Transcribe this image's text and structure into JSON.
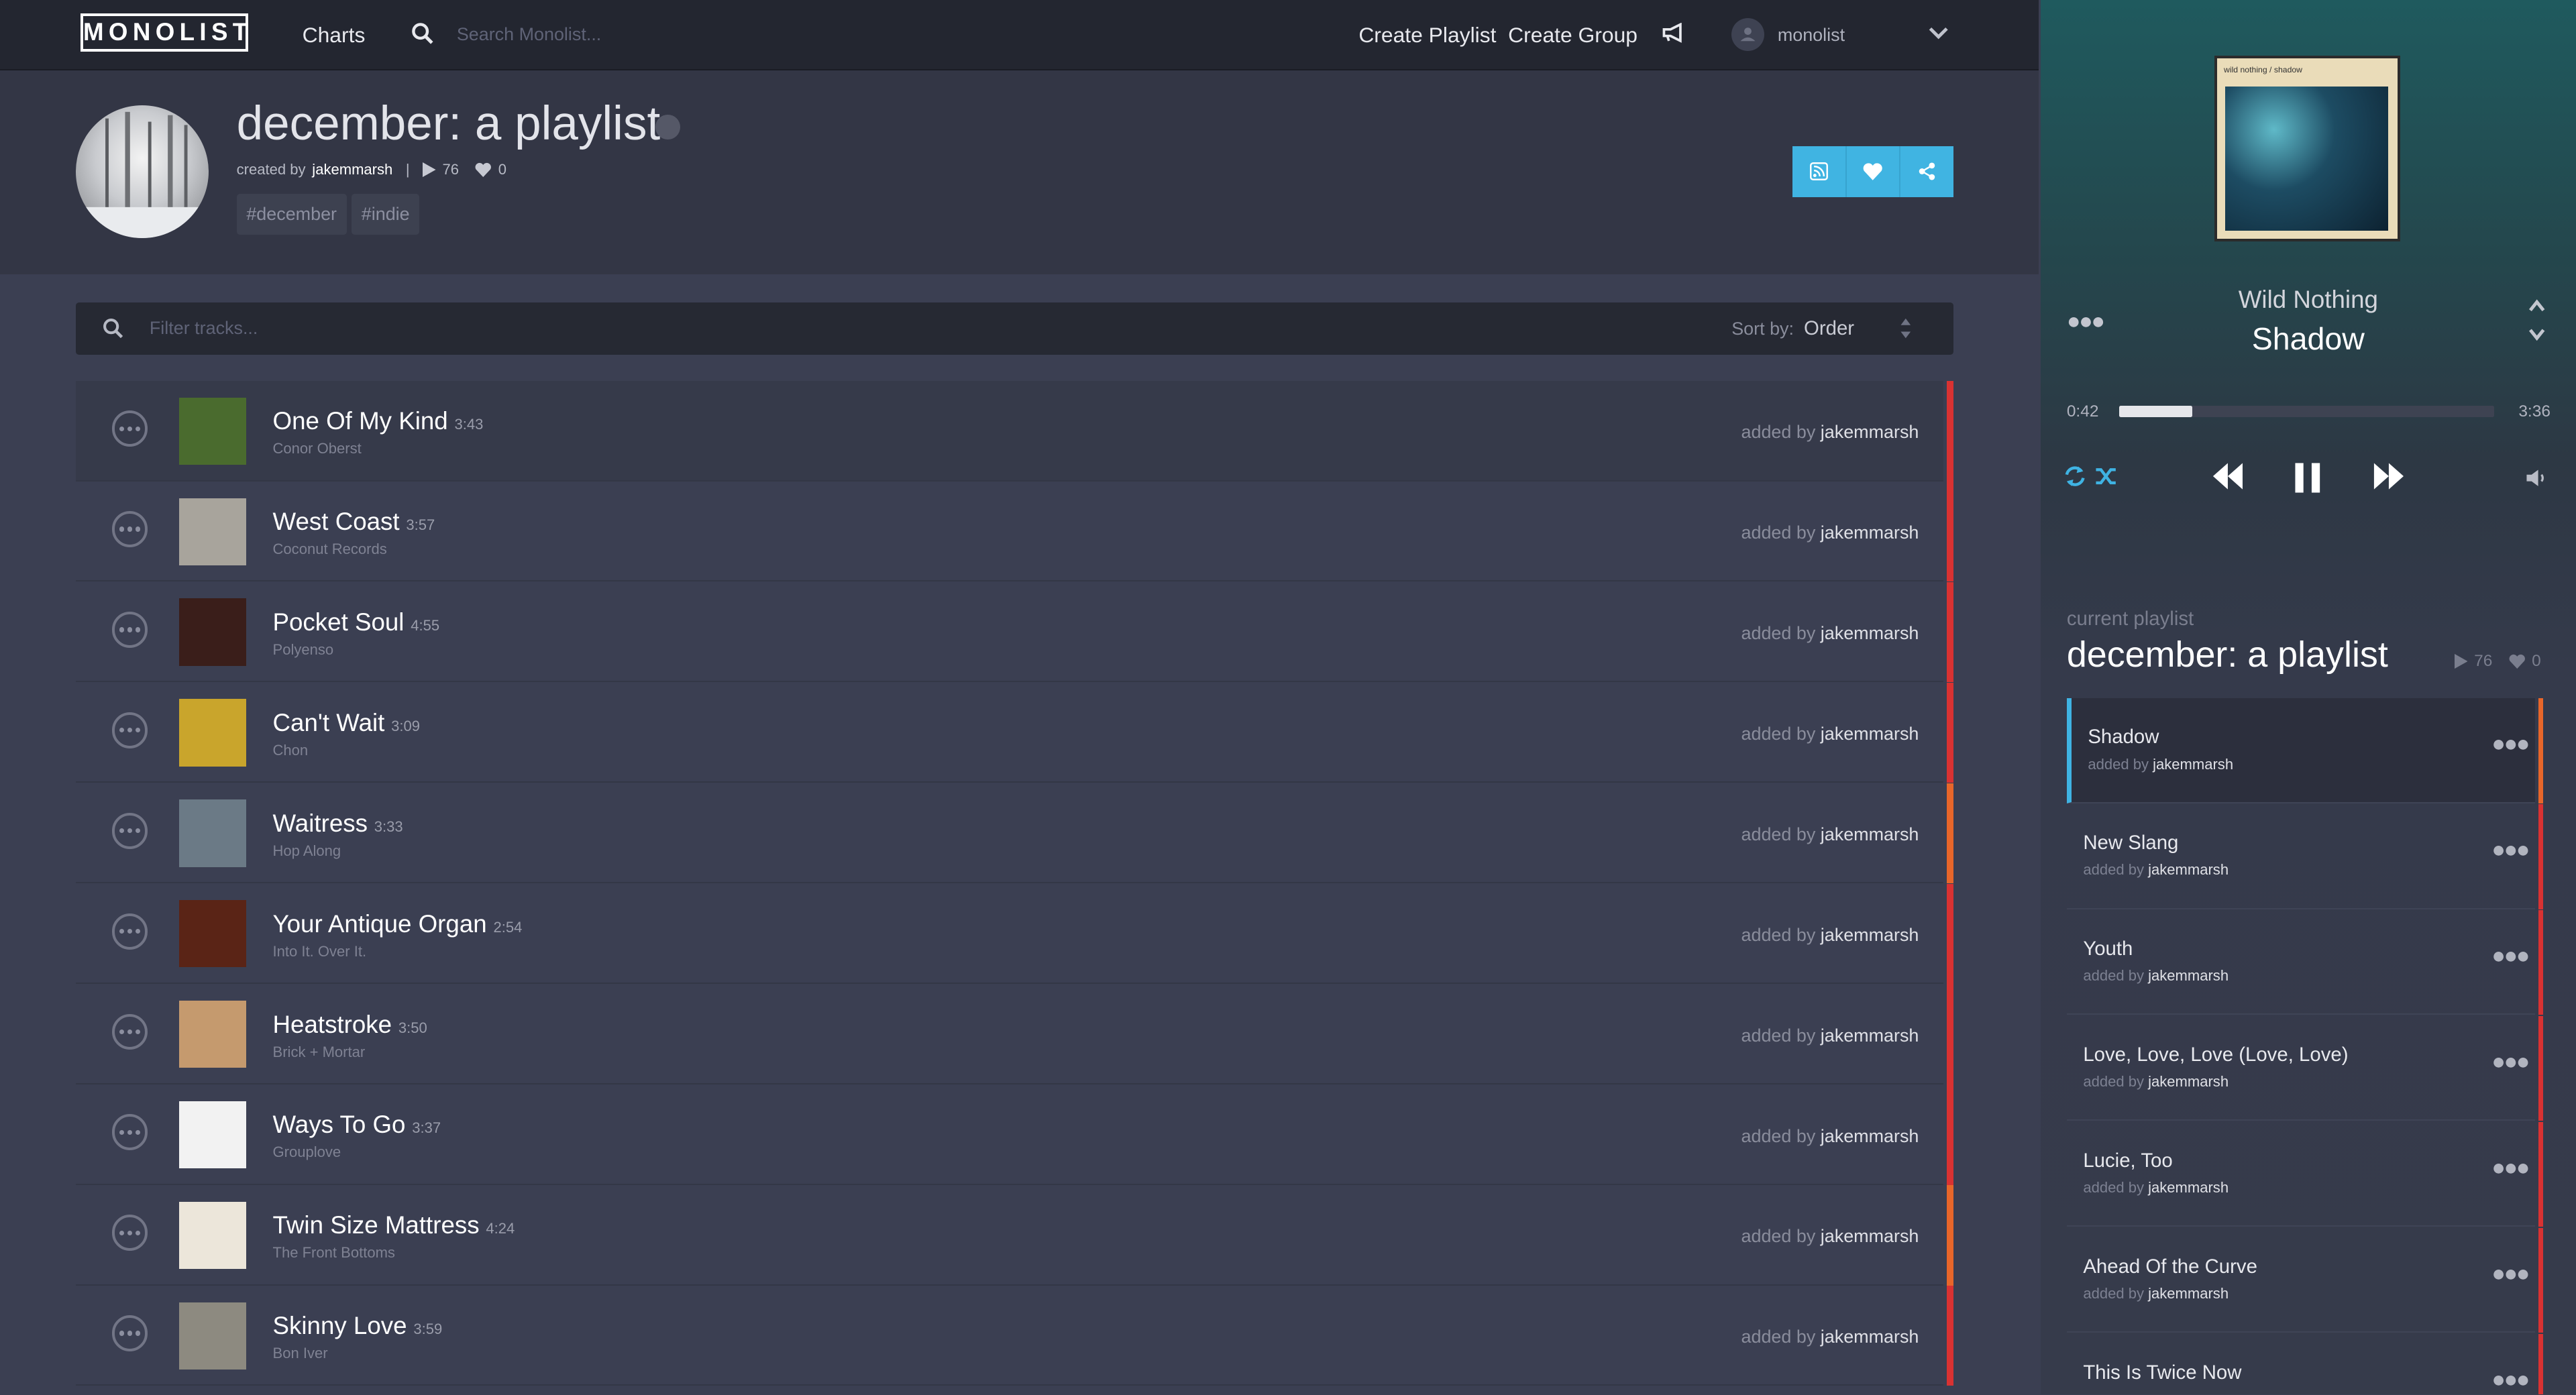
{
  "nav": {
    "logo": "MONOLIST",
    "charts": "Charts",
    "search_placeholder": "Search Monolist...",
    "create_playlist": "Create Playlist",
    "create_group": "Create Group",
    "username": "monolist"
  },
  "playlist": {
    "title": "december: a playlist",
    "created_by_label": "created by",
    "creator": "jakemmarsh",
    "separator": "|",
    "plays": "76",
    "likes": "0",
    "tags": [
      "#december",
      "#indie"
    ]
  },
  "filter": {
    "placeholder": "Filter tracks...",
    "sort_label": "Sort by:",
    "sort_value": "Order"
  },
  "added_by_label": "added by",
  "tracks": [
    {
      "title": "One Of My Kind",
      "duration": "3:43",
      "artist": "Conor Oberst",
      "added_by": "jakemmarsh",
      "bar_color": "#d93232",
      "thumb_color": "#4a6b2e"
    },
    {
      "title": "West Coast",
      "duration": "3:57",
      "artist": "Coconut Records",
      "added_by": "jakemmarsh",
      "bar_color": "#d93232",
      "thumb_color": "#a8a49c"
    },
    {
      "title": "Pocket Soul",
      "duration": "4:55",
      "artist": "Polyenso",
      "added_by": "jakemmarsh",
      "bar_color": "#d93232",
      "thumb_color": "#3a1e1a"
    },
    {
      "title": "Can't Wait",
      "duration": "3:09",
      "artist": "Chon",
      "added_by": "jakemmarsh",
      "bar_color": "#d93232",
      "thumb_color": "#c9a52c"
    },
    {
      "title": "Waitress",
      "duration": "3:33",
      "artist": "Hop Along",
      "added_by": "jakemmarsh",
      "bar_color": "#e8662a",
      "thumb_color": "#6b7a86"
    },
    {
      "title": "Your Antique Organ",
      "duration": "2:54",
      "artist": "Into It. Over It.",
      "added_by": "jakemmarsh",
      "bar_color": "#d93232",
      "thumb_color": "#5a2416"
    },
    {
      "title": "Heatstroke",
      "duration": "3:50",
      "artist": "Brick + Mortar",
      "added_by": "jakemmarsh",
      "bar_color": "#d93232",
      "thumb_color": "#c59a6e"
    },
    {
      "title": "Ways To Go",
      "duration": "3:37",
      "artist": "Grouplove",
      "added_by": "jakemmarsh",
      "bar_color": "#d93232",
      "thumb_color": "#f2f2f2"
    },
    {
      "title": "Twin Size Mattress",
      "duration": "4:24",
      "artist": "The Front Bottoms",
      "added_by": "jakemmarsh",
      "bar_color": "#e8662a",
      "thumb_color": "#ece6da"
    },
    {
      "title": "Skinny Love",
      "duration": "3:59",
      "artist": "Bon Iver",
      "added_by": "jakemmarsh",
      "bar_color": "#d93232",
      "thumb_color": "#8d8a80"
    }
  ],
  "player": {
    "artist": "Wild Nothing",
    "title": "Shadow",
    "album_text": "wild nothing / shadow",
    "time_current": "0:42",
    "time_total": "3:36",
    "progress": 0.194
  },
  "current_playlist": {
    "label": "current playlist",
    "title": "december: a playlist",
    "plays": "76",
    "likes": "0"
  },
  "queue": [
    {
      "title": "Shadow",
      "added_by": "jakemmarsh",
      "bar_color": "#e8662a"
    },
    {
      "title": "New Slang",
      "added_by": "jakemmarsh",
      "bar_color": "#d93232"
    },
    {
      "title": "Youth",
      "added_by": "jakemmarsh",
      "bar_color": "#d93232"
    },
    {
      "title": "Love, Love, Love (Love, Love)",
      "added_by": "jakemmarsh",
      "bar_color": "#d93232"
    },
    {
      "title": "Lucie, Too",
      "added_by": "jakemmarsh",
      "bar_color": "#d93232"
    },
    {
      "title": "Ahead Of the Curve",
      "added_by": "jakemmarsh",
      "bar_color": "#d93232"
    },
    {
      "title": "This Is Twice Now",
      "added_by": "",
      "bar_color": "#d93232"
    }
  ],
  "colors": {
    "accent": "#40b4e2",
    "bar_red": "#d93232",
    "bar_orange": "#e8662a"
  }
}
